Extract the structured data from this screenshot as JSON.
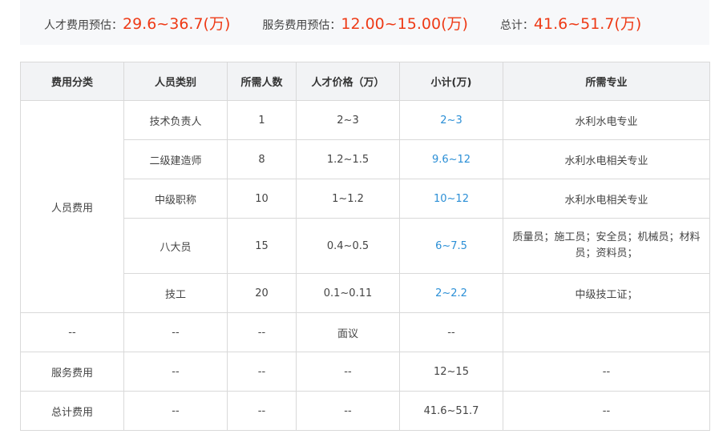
{
  "summary": {
    "talent_label": "人才费用预估：",
    "talent_value": "29.6~36.7(万)",
    "service_label": "服务费用预估：",
    "service_value": "12.00~15.00(万)",
    "total_label": "总计：",
    "total_value": "41.6~51.7(万)"
  },
  "table": {
    "headers": [
      "费用分类",
      "人员类别",
      "所需人数",
      "人才价格（万）",
      "小计(万)",
      "所需专业"
    ],
    "personnel_category": "人员费用",
    "personnel_rows": [
      {
        "type": "技术负责人",
        "count": "1",
        "price": "2~3",
        "subtotal": "2~3",
        "major": "水利水电专业"
      },
      {
        "type": "二级建造师",
        "count": "8",
        "price": "1.2~1.5",
        "subtotal": "9.6~12",
        "major": "水利水电相关专业"
      },
      {
        "type": "中级职称",
        "count": "10",
        "price": "1~1.2",
        "subtotal": "10~12",
        "major": "水利水电相关专业"
      },
      {
        "type": "八大员",
        "count": "15",
        "price": "0.4~0.5",
        "subtotal": "6~7.5",
        "major": "质量员；施工员；安全员；机械员；材料员；资料员；"
      },
      {
        "type": "技工",
        "count": "20",
        "price": "0.1~0.11",
        "subtotal": "2~2.2",
        "major": "中级技工证；"
      }
    ],
    "other_row": {
      "category": "--",
      "type": "--",
      "count": "--",
      "price": "面议",
      "subtotal": "--",
      "major": ""
    },
    "service_row": {
      "category": "服务费用",
      "type": "--",
      "count": "--",
      "price": "--",
      "subtotal": "12~15",
      "major": "--"
    },
    "total_row": {
      "category": "总计费用",
      "type": "--",
      "count": "--",
      "price": "--",
      "subtotal": "41.6~51.7",
      "major": "--"
    }
  },
  "colors": {
    "accent_red": "#ee3a16",
    "link_blue": "#2b8fd6",
    "header_bg": "#f2f3f5",
    "summary_bg": "#f7f8fa"
  }
}
